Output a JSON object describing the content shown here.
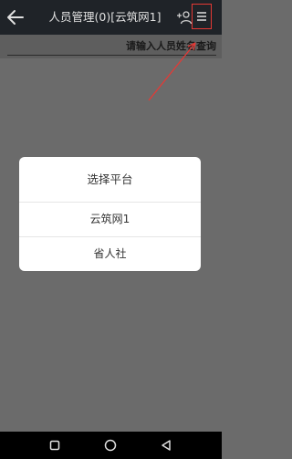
{
  "header": {
    "title": "人员管理(0)[云筑网1]",
    "back_icon": "back-arrow-icon",
    "add_icon": "add-person-icon",
    "menu_icon": "hamburger-menu-icon"
  },
  "search": {
    "placeholder": "请输入人员姓名查询"
  },
  "dialog": {
    "title": "选择平台",
    "options": [
      {
        "label": "云筑网1"
      },
      {
        "label": "省人社"
      }
    ]
  },
  "annotation": {
    "color": "#e53935"
  },
  "navbar": {
    "icons": [
      "square-icon",
      "circle-icon",
      "back-triangle-icon"
    ]
  }
}
